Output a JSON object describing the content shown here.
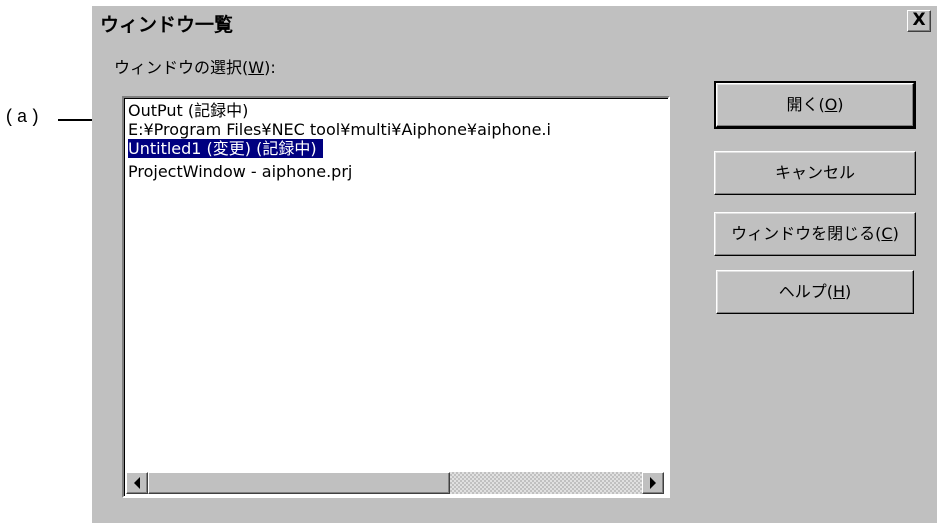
{
  "annotation": {
    "label": "(a)"
  },
  "dialog": {
    "title": "ウィンドウ一覧",
    "close_glyph": "X",
    "list_caption": {
      "text": "ウィンドウの選択(",
      "accel": "W",
      "suffix": "):"
    },
    "items": [
      {
        "label": "OutPut (記録中)",
        "selected": false
      },
      {
        "label": "E:¥Program Files¥NEC tool¥multi¥Aiphone¥aiphone.i",
        "selected": false
      },
      {
        "label": "Untitled1 (変更) (記録中)",
        "selected": true
      },
      {
        "label": "ProjectWindow - aiphone.prj",
        "selected": false
      }
    ],
    "buttons": {
      "open": {
        "text": "開く(",
        "accel": "O",
        "suffix": ")"
      },
      "cancel": {
        "text": "キャンセル"
      },
      "close_window": {
        "text": "ウィンドウを閉じる(",
        "accel": "C",
        "suffix": ")"
      },
      "help": {
        "text": "ヘルプ(",
        "accel": "H",
        "suffix": ")"
      }
    }
  }
}
